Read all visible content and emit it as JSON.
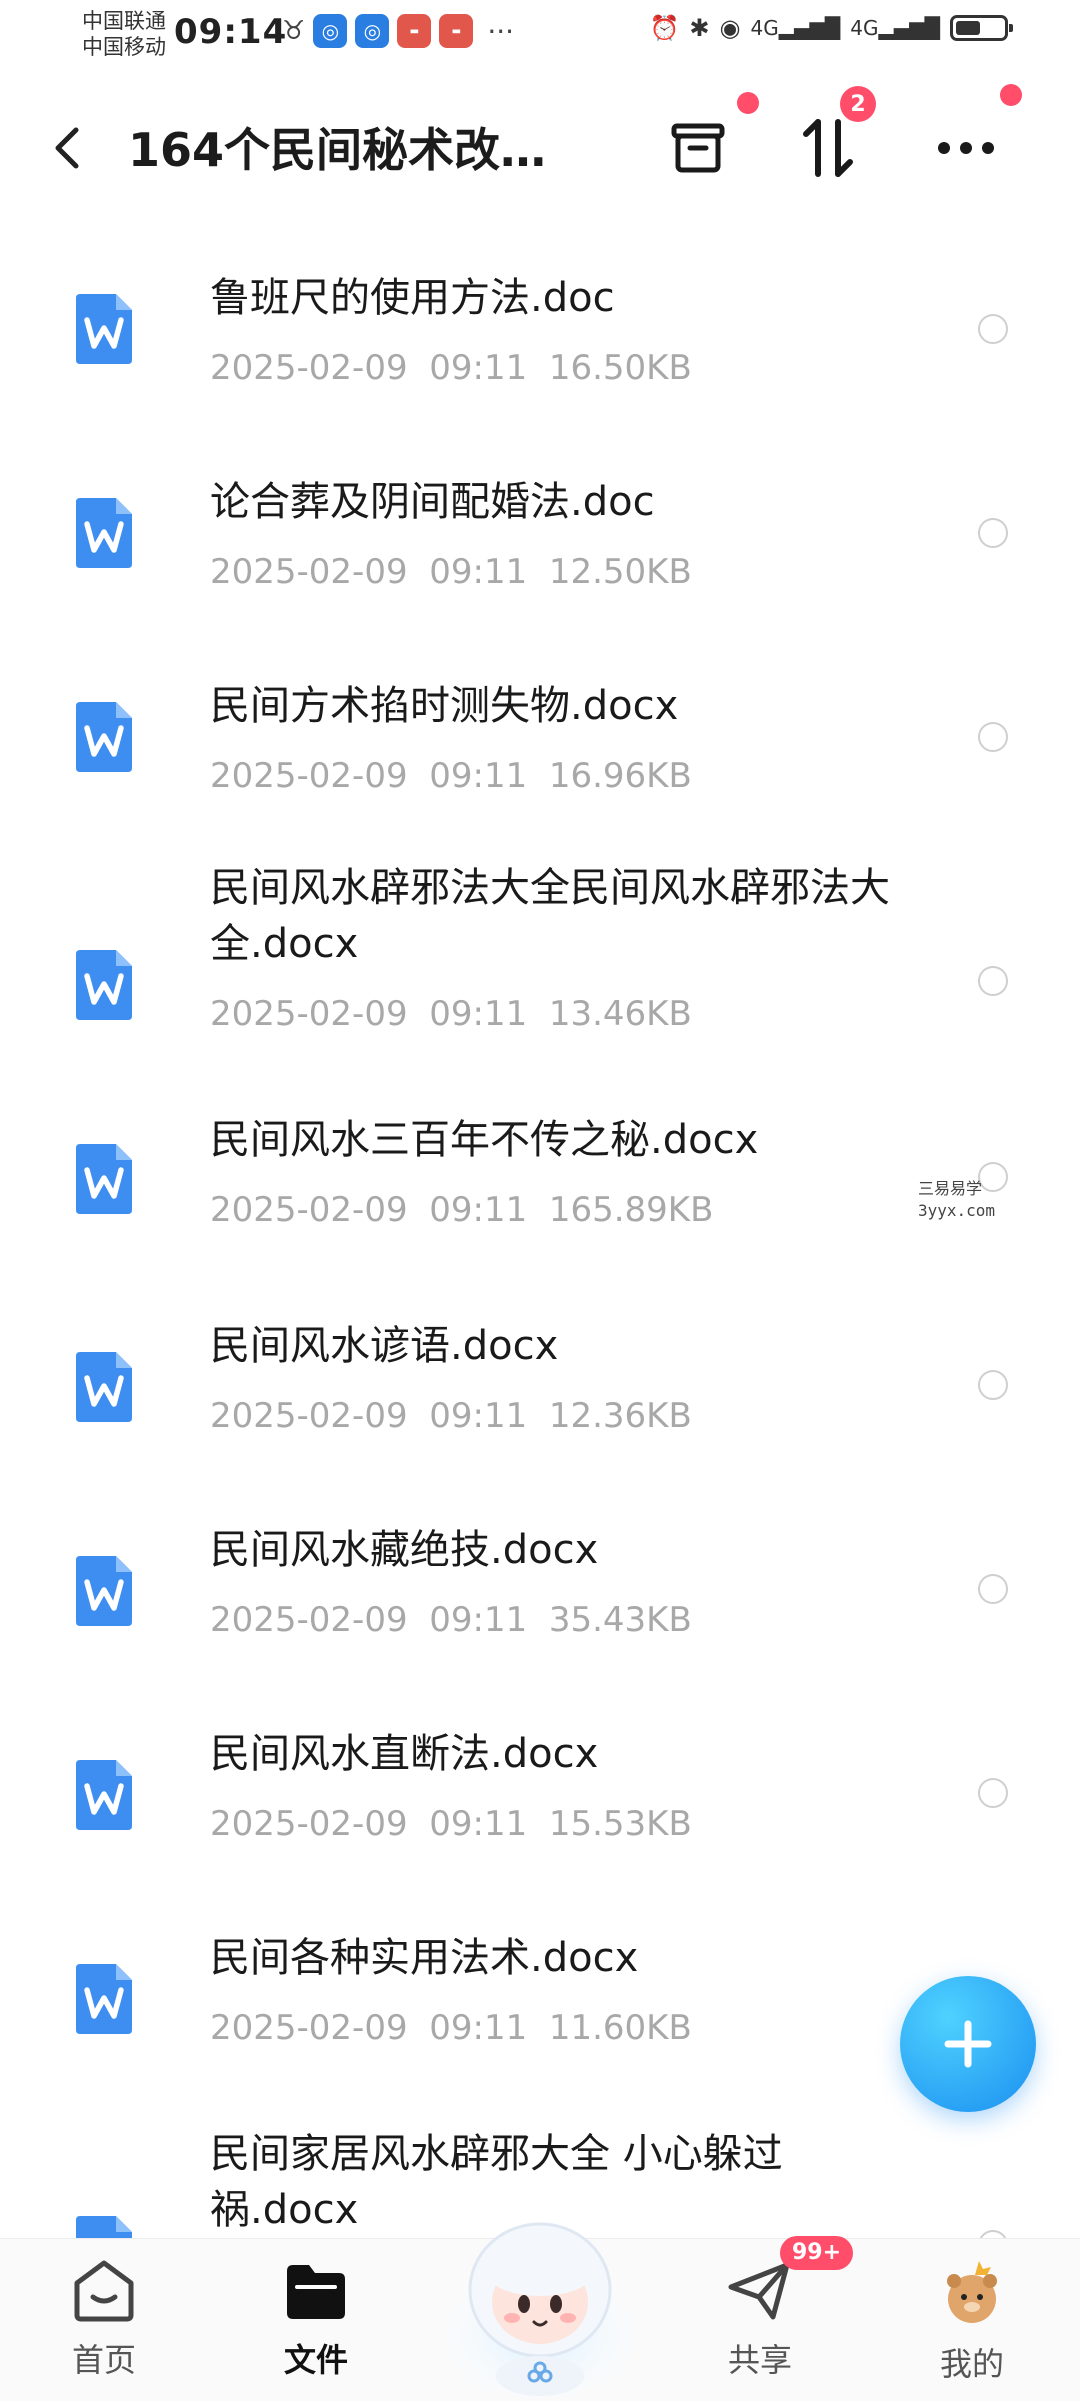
{
  "status_bar": {
    "carrier_1": "中国联通",
    "carrier_2": "中国移动",
    "time": "09:14",
    "dots": "···",
    "net_1": "4G",
    "net_2": "4G"
  },
  "header": {
    "title": "164个民间秘术改…",
    "sort_badge": "2"
  },
  "files": [
    {
      "name": "鲁班尺的使用方法.doc",
      "date": "2025-02-09",
      "time": "09:11",
      "size": "16.50KB"
    },
    {
      "name": "论合葬及阴间配婚法.doc",
      "date": "2025-02-09",
      "time": "09:11",
      "size": "12.50KB"
    },
    {
      "name": "民间方术掐时测失物.docx",
      "date": "2025-02-09",
      "time": "09:11",
      "size": "16.96KB"
    },
    {
      "name": "民间风水辟邪法大全民间风水辟邪法大全.docx",
      "date": "2025-02-09",
      "time": "09:11",
      "size": "13.46KB"
    },
    {
      "name": "民间风水三百年不传之秘.docx",
      "date": "2025-02-09",
      "time": "09:11",
      "size": "165.89KB"
    },
    {
      "name": "民间风水谚语.docx",
      "date": "2025-02-09",
      "time": "09:11",
      "size": "12.36KB"
    },
    {
      "name": "民间风水藏绝技.docx",
      "date": "2025-02-09",
      "time": "09:11",
      "size": "35.43KB"
    },
    {
      "name": "民间风水直断法.docx",
      "date": "2025-02-09",
      "time": "09:11",
      "size": "15.53KB"
    },
    {
      "name": "民间各种实用法术.docx",
      "date": "2025-02-09",
      "time": "09:11",
      "size": "11.60KB"
    },
    {
      "name": "民间家居风水辟邪大全 小心躲过祸.docx",
      "date": "",
      "time": "",
      "size": ""
    }
  ],
  "watermark": {
    "line_1": "三易易学",
    "line_2": "3yyx.com"
  },
  "bottom_nav": {
    "home": "首页",
    "files": "文件",
    "share": "共享",
    "mine": "我的",
    "share_badge": "99+"
  },
  "colors": {
    "accent": "#2f86f6",
    "badge": "#ff4d6a",
    "meta_text": "#a8a8a8"
  }
}
